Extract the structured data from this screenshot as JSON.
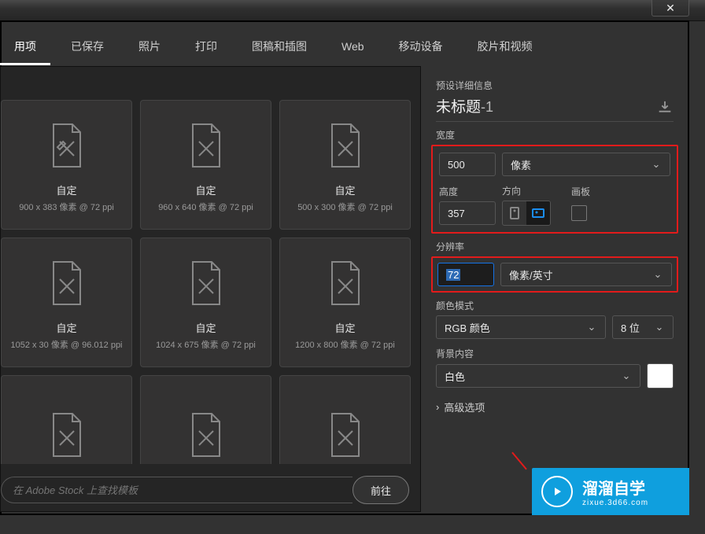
{
  "tabs": {
    "recent": "用项",
    "saved": "已保存",
    "photo": "照片",
    "print": "打印",
    "art": "图稿和插图",
    "web": "Web",
    "mobile": "移动设备",
    "film": "胶片和视频"
  },
  "presets": [
    {
      "name": "自定",
      "meta": "900 x 383 像素 @ 72 ppi"
    },
    {
      "name": "自定",
      "meta": "960 x 640 像素 @ 72 ppi"
    },
    {
      "name": "自定",
      "meta": "500 x 300 像素 @ 72 ppi"
    },
    {
      "name": "自定",
      "meta": "1052 x 30 像素 @ 96.012 ppi"
    },
    {
      "name": "自定",
      "meta": "1024 x 675 像素 @ 72 ppi"
    },
    {
      "name": "自定",
      "meta": "1200 x 800 像素 @ 72 ppi"
    },
    {
      "name": "",
      "meta": ""
    },
    {
      "name": "",
      "meta": ""
    },
    {
      "name": "",
      "meta": ""
    }
  ],
  "stock": {
    "placeholder": "在 Adobe Stock 上查找模板",
    "go": "前往"
  },
  "detail": {
    "section_head": "预设详细信息",
    "title_main": "未标题",
    "title_suffix": "-1",
    "width_label": "宽度",
    "width_value": "500",
    "width_unit": "像素",
    "height_label": "高度",
    "height_value": "357",
    "orientation_label": "方向",
    "artboard_label": "画板",
    "resolution_label": "分辨率",
    "resolution_value": "72",
    "resolution_unit": "像素/英寸",
    "colormode_label": "颜色模式",
    "colormode_value": "RGB 颜色",
    "bitdepth_value": "8 位",
    "bg_label": "背景内容",
    "bg_value": "白色",
    "advanced_label": "高级选项"
  },
  "watermark": {
    "text1": "溜溜自学",
    "text2": "zixue.3d66.com"
  }
}
